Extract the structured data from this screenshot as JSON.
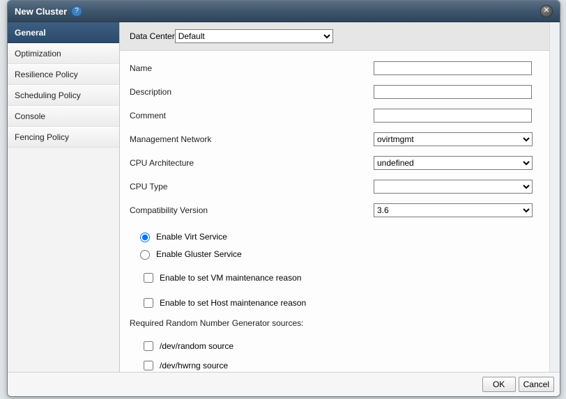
{
  "dialog": {
    "title": "New Cluster",
    "help_glyph": "?",
    "close_glyph": "✕"
  },
  "sidebar": {
    "tabs": [
      {
        "label": "General",
        "active": true
      },
      {
        "label": "Optimization",
        "active": false
      },
      {
        "label": "Resilience Policy",
        "active": false
      },
      {
        "label": "Scheduling Policy",
        "active": false
      },
      {
        "label": "Console",
        "active": false
      },
      {
        "label": "Fencing Policy",
        "active": false
      }
    ]
  },
  "form": {
    "data_center_label": "Data Center",
    "data_center_value": "Default",
    "name_label": "Name",
    "name_value": "",
    "description_label": "Description",
    "description_value": "",
    "comment_label": "Comment",
    "comment_value": "",
    "management_network_label": "Management Network",
    "management_network_value": "ovirtmgmt",
    "cpu_architecture_label": "CPU Architecture",
    "cpu_architecture_value": "undefined",
    "cpu_type_label": "CPU Type",
    "cpu_type_value": "",
    "compat_version_label": "Compatibility Version",
    "compat_version_value": "3.6",
    "enable_virt_label": "Enable Virt Service",
    "enable_gluster_label": "Enable Gluster Service",
    "vm_maint_reason_label": "Enable to set VM maintenance reason",
    "host_maint_reason_label": "Enable to set Host maintenance reason",
    "rng_title": "Required Random Number Generator sources:",
    "rng_random_label": "/dev/random source",
    "rng_hwrng_label": "/dev/hwrng source"
  },
  "footer": {
    "ok_label": "OK",
    "cancel_label": "Cancel"
  }
}
